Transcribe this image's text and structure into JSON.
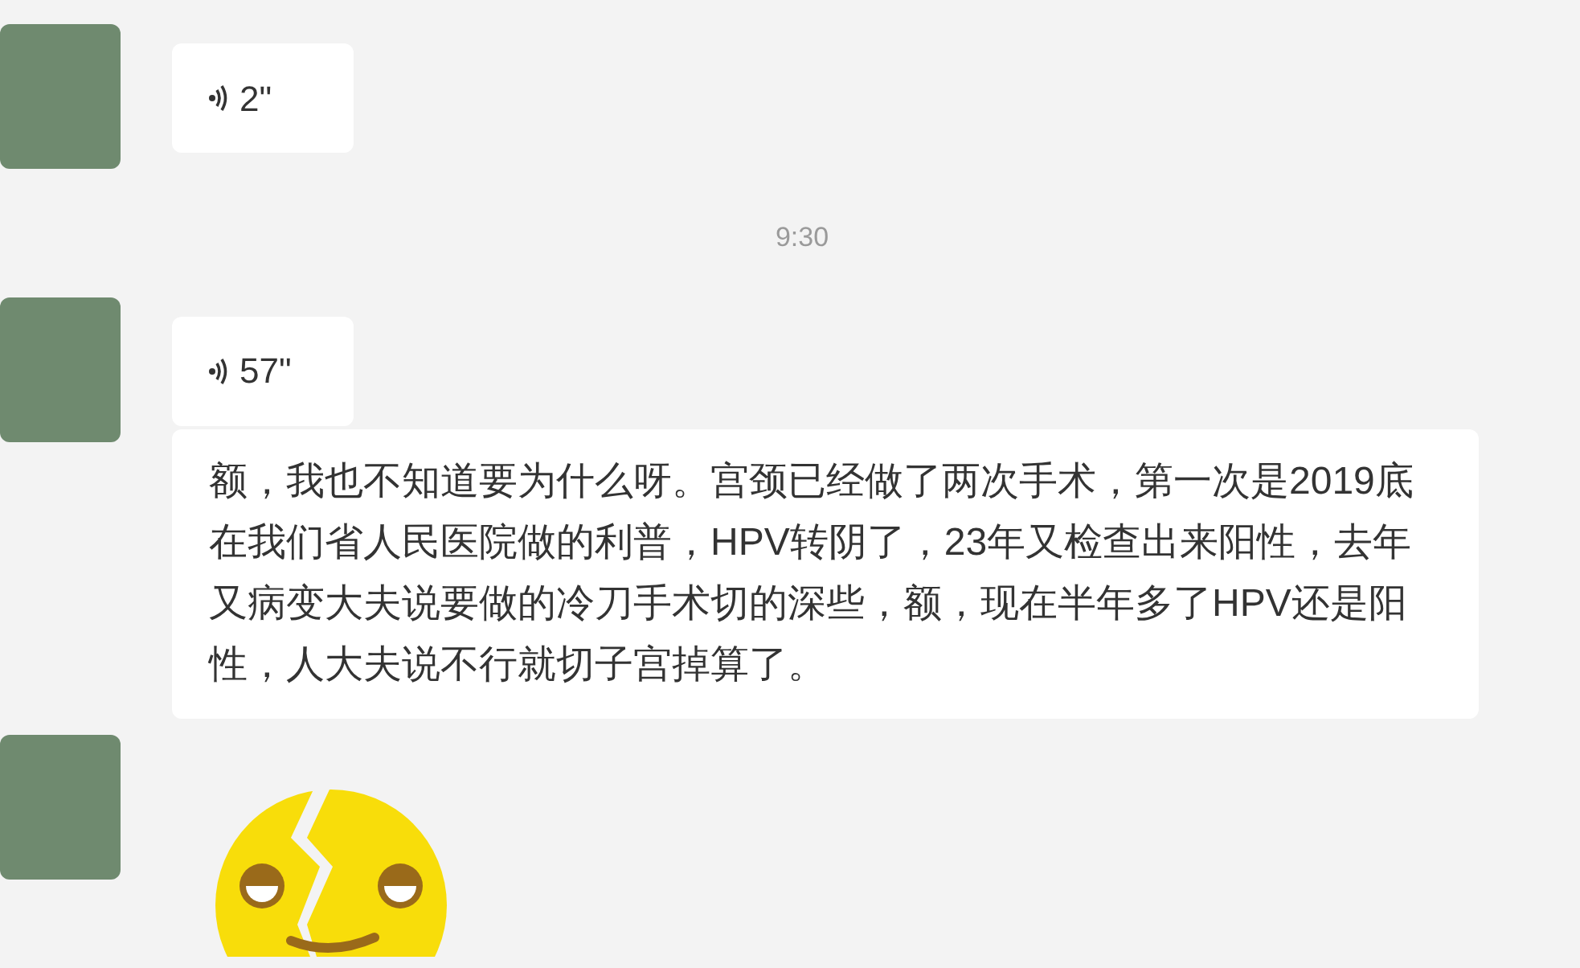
{
  "messages": [
    {
      "kind": "voice",
      "duration": "2\""
    },
    {
      "kind": "time",
      "text": "9:30"
    },
    {
      "kind": "voice",
      "duration": "57\""
    },
    {
      "kind": "text",
      "text": "额，我也不知道要为什么呀。宫颈已经做了两次手术，第一次是2019底在我们省人民医院做的利普，HPV转阴了，23年又检查出来阳性，去年又病变大夫说要做的冷刀手术切的深些，额，现在半年多了HPV还是阳性，人大夫说不行就切子宫掉算了。"
    },
    {
      "kind": "sticker"
    }
  ]
}
